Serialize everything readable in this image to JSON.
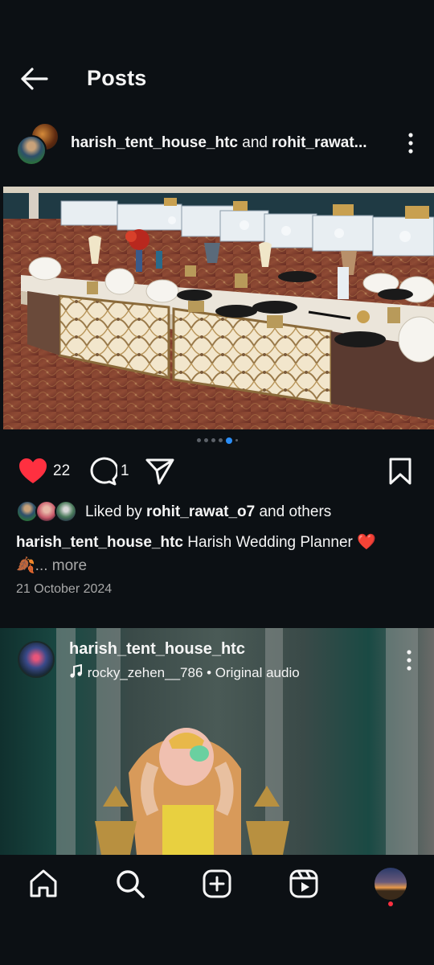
{
  "header": {
    "title": "Posts"
  },
  "post": {
    "user1": "harish_tent_house_htc",
    "joiner": " and ",
    "user2": "rohit_rawat...",
    "likes_count": "22",
    "comments_count": "1",
    "liked_by_prefix": "Liked by ",
    "liked_by_user": "rohit_rawat_o7",
    "liked_by_suffix": " and others",
    "caption_user": "harish_tent_house_htc",
    "caption_text": " Harish Wedding Planner ❤️",
    "caption_line2": "🍂",
    "caption_more": "... more",
    "date": "21 October 2024",
    "carousel": {
      "total": 6,
      "active_index": 4
    }
  },
  "reel": {
    "user": "harish_tent_house_htc",
    "audio": "rocky_zehen__786 • Original audio"
  },
  "colors": {
    "background": "#0c1014",
    "like": "#ff3040",
    "accent_dot": "#2b8ef7",
    "secondary_text": "#a8a8a8"
  },
  "icons": [
    "back-arrow-icon",
    "more-vertical-icon",
    "heart-filled-icon",
    "comment-icon",
    "share-icon",
    "bookmark-icon",
    "music-note-icon",
    "home-icon",
    "search-icon",
    "create-icon",
    "reels-icon"
  ]
}
